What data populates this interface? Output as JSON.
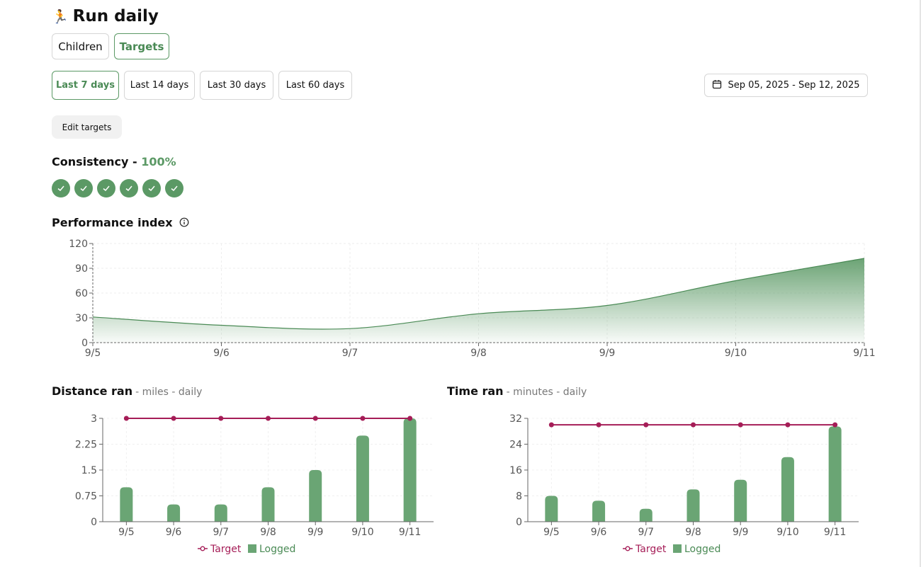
{
  "header": {
    "icon": "runner-icon",
    "title": "Run daily"
  },
  "view_tabs": [
    {
      "label": "Children",
      "active": false
    },
    {
      "label": "Targets",
      "active": true
    }
  ],
  "ranges": [
    {
      "label": "Last 7 days",
      "active": true
    },
    {
      "label": "Last 14 days",
      "active": false
    },
    {
      "label": "Last 30 days",
      "active": false
    },
    {
      "label": "Last 60 days",
      "active": false
    }
  ],
  "date_range": {
    "icon": "calendar-icon",
    "label": "Sep 05, 2025 - Sep 12, 2025"
  },
  "edit_targets_label": "Edit targets",
  "consistency": {
    "label": "Consistency -",
    "value": "100%",
    "checks": 6
  },
  "performance": {
    "title": "Performance index"
  },
  "distance": {
    "title": "Distance ran",
    "subtitle": "- miles - daily"
  },
  "time": {
    "title": "Time ran",
    "subtitle": "- minutes - daily"
  },
  "colors": {
    "accent": "#5b9965",
    "target": "#a51d57",
    "bar": "#6aa574"
  },
  "chart_data": [
    {
      "id": "performance",
      "type": "area",
      "x": [
        "9/5",
        "9/6",
        "9/7",
        "9/8",
        "9/9",
        "9/10",
        "9/11"
      ],
      "values": [
        31,
        21,
        17,
        35,
        45,
        75,
        102
      ],
      "ylim": [
        0,
        120
      ],
      "yticks": [
        0,
        30,
        60,
        90,
        120
      ],
      "grid": true
    },
    {
      "id": "distance",
      "type": "bar",
      "categories": [
        "9/5",
        "9/6",
        "9/7",
        "9/8",
        "9/9",
        "9/10",
        "9/11"
      ],
      "series": [
        {
          "name": "Target",
          "type": "line",
          "values": [
            3,
            3,
            3,
            3,
            3,
            3,
            3
          ]
        },
        {
          "name": "Logged",
          "type": "bar",
          "values": [
            1,
            0.5,
            0.5,
            1,
            1.5,
            2.5,
            3
          ]
        }
      ],
      "ylim": [
        0,
        3
      ],
      "yticks": [
        "0",
        "0.75",
        "1.5",
        "2.25",
        "3"
      ],
      "legend": "bottom"
    },
    {
      "id": "time",
      "type": "bar",
      "categories": [
        "9/5",
        "9/6",
        "9/7",
        "9/8",
        "9/9",
        "9/10",
        "9/11"
      ],
      "series": [
        {
          "name": "Target",
          "type": "line",
          "values": [
            30,
            30,
            30,
            30,
            30,
            30,
            30
          ]
        },
        {
          "name": "Logged",
          "type": "bar",
          "values": [
            8,
            6.5,
            4,
            10,
            13,
            20,
            29.5
          ]
        }
      ],
      "ylim": [
        0,
        32
      ],
      "yticks": [
        "0",
        "8",
        "16",
        "24",
        "32"
      ],
      "legend": "bottom"
    }
  ]
}
